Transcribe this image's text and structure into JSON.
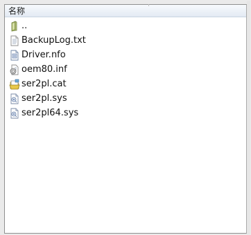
{
  "list": {
    "column_header": "名称",
    "items": [
      {
        "name": "..",
        "icon": "folder-up-icon"
      },
      {
        "name": "BackupLog.txt",
        "icon": "text-file-icon"
      },
      {
        "name": "Driver.nfo",
        "icon": "info-file-icon"
      },
      {
        "name": "oem80.inf",
        "icon": "setup-info-file-icon"
      },
      {
        "name": "ser2pl.cat",
        "icon": "security-catalog-icon"
      },
      {
        "name": "ser2pl.sys",
        "icon": "system-file-icon"
      },
      {
        "name": "ser2pl64.sys",
        "icon": "system-file-icon"
      }
    ]
  }
}
